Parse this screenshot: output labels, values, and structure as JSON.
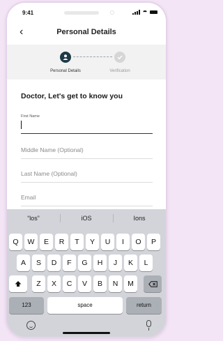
{
  "status": {
    "time": "9:41"
  },
  "header": {
    "title": "Personal Details",
    "back_icon": "chevron-left-icon"
  },
  "stepper": {
    "steps": [
      {
        "label": "Personal Details",
        "state": "active"
      },
      {
        "label": "Verification",
        "state": "pending"
      }
    ]
  },
  "form": {
    "heading": "Doctor, Let's get to know you",
    "first_name_label": "First Name",
    "first_name_value": "",
    "middle_name_placeholder": "Middle Name (Optional)",
    "last_name_placeholder": "Last Name (Optional)",
    "email_placeholder": "Email"
  },
  "keyboard": {
    "suggestions": [
      "“los”",
      "iOS",
      "Ions"
    ],
    "row1": [
      "Q",
      "W",
      "E",
      "R",
      "T",
      "Y",
      "U",
      "I",
      "O",
      "P"
    ],
    "row2": [
      "A",
      "S",
      "D",
      "F",
      "G",
      "H",
      "J",
      "K",
      "L"
    ],
    "row3": [
      "Z",
      "X",
      "C",
      "V",
      "B",
      "N",
      "M"
    ],
    "numbers_label": "123",
    "space_label": "space",
    "return_label": "return"
  },
  "colors": {
    "accent": "#1f3a47",
    "background": "#f3e5f5"
  }
}
